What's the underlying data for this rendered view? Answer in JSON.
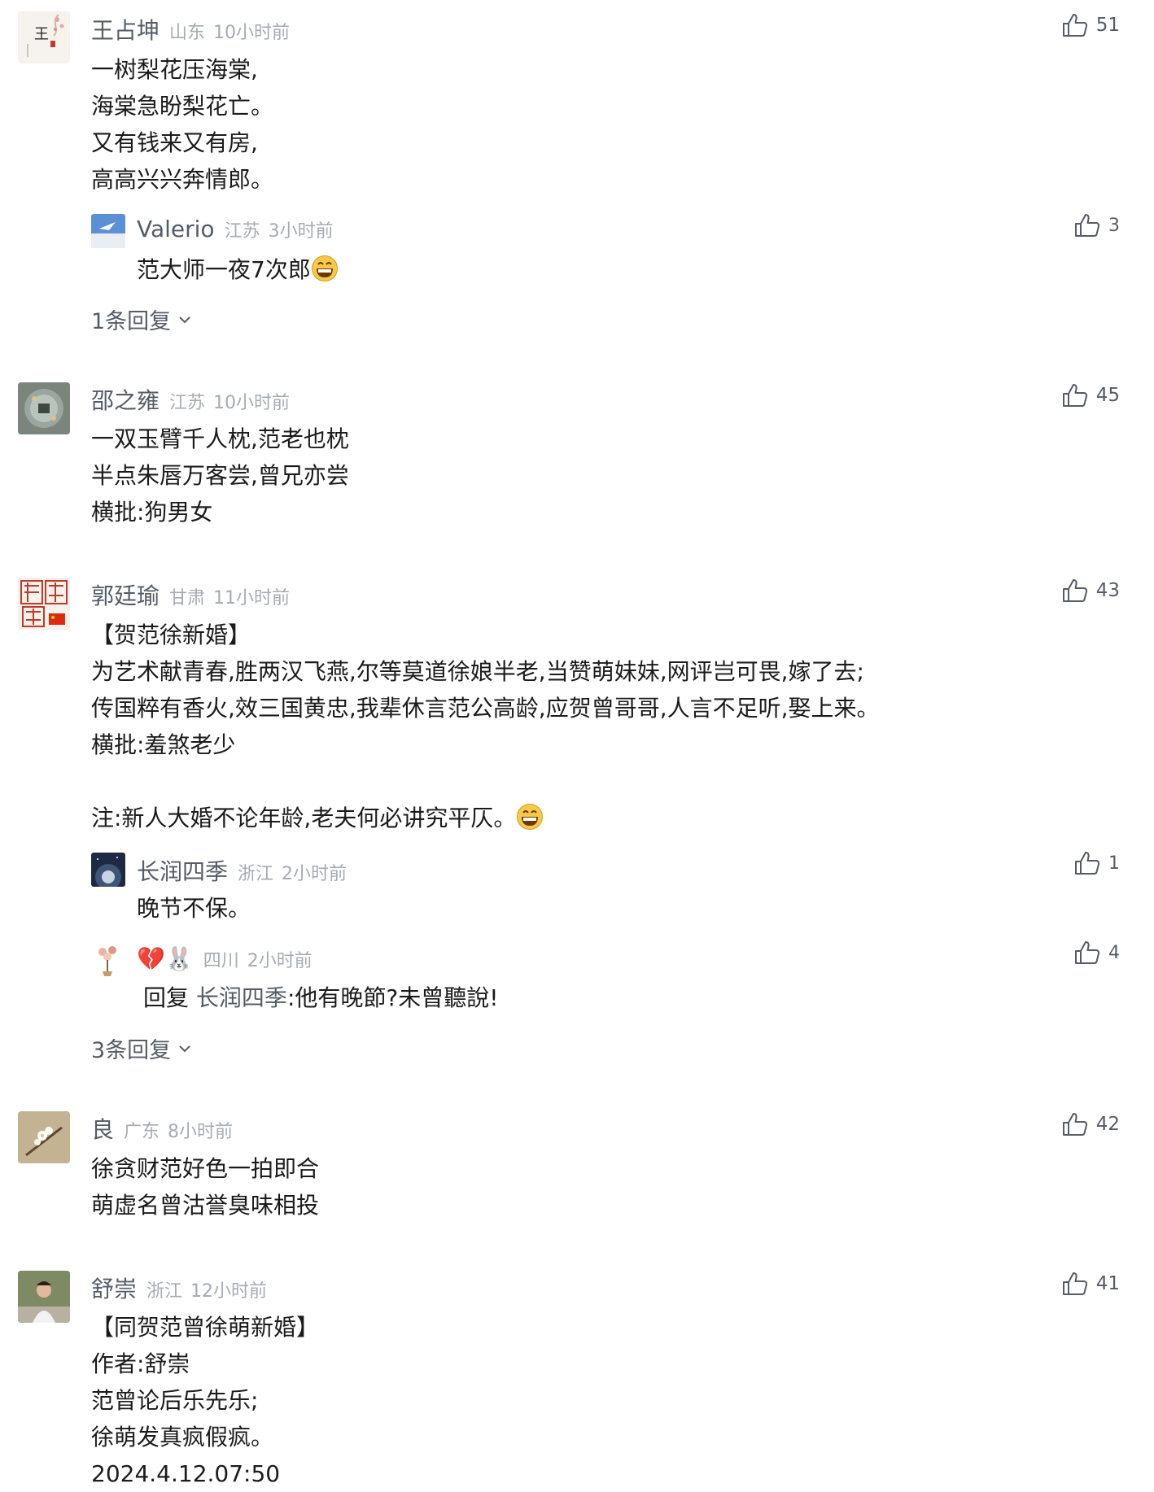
{
  "comments": [
    {
      "name": "王占坤",
      "region": "山东",
      "time": "10小时前",
      "likes": "51",
      "lines": [
        "一树梨花压海棠,",
        "海棠急盼梨花亡。",
        "又有钱来又有房,",
        "高高兴兴奔情郎。"
      ],
      "replies": [
        {
          "name": "Valerio",
          "region": "江苏",
          "time": "3小时前",
          "likes": "3",
          "text": "范大师一夜7次郎",
          "emoji": "grinning-face-emoji"
        }
      ],
      "more": "1条回复"
    },
    {
      "name": "邵之雍",
      "region": "江苏",
      "time": "10小时前",
      "likes": "45",
      "lines": [
        "一双玉臂千人枕,范老也枕",
        "半点朱唇万客尝,曾兄亦尝",
        "横批:狗男女"
      ]
    },
    {
      "name": "郭廷瑜",
      "region": "甘肃",
      "time": "11小时前",
      "likes": "43",
      "lines": [
        "【贺范徐新婚】",
        "为艺术献青春,胜两汉飞燕,尔等莫道徐娘半老,当赞萌妹妹,网评岂可畏,嫁了去;",
        "传国粹有香火,效三国黄忠,我辈休言范公高龄,应贺曾哥哥,人言不足听,娶上来。",
        "横批:羞煞老少",
        "",
        "注:新人大婚不论年龄,老夫何必讲究平仄。"
      ],
      "replies": [
        {
          "name": "长润四季",
          "region": "浙江",
          "time": "2小时前",
          "likes": "1",
          "text": "晚节不保。"
        },
        {
          "name": "💔🐰",
          "region": "四川",
          "time": "2小时前",
          "likes": "4",
          "reply_prefix": "回复",
          "reply_to": "长润四季",
          "text": ":他有晚節?未曾聽說!"
        }
      ],
      "more": "3条回复"
    },
    {
      "name": "良",
      "region": "广东",
      "time": "8小时前",
      "likes": "42",
      "lines": [
        "徐贪财范好色一拍即合",
        "萌虚名曾沽誉臭味相投"
      ]
    },
    {
      "name": "舒崇",
      "region": "浙江",
      "time": "12小时前",
      "likes": "41",
      "lines": [
        "【同贺范曾徐萌新婚】",
        "作者:舒崇",
        "范曾论后乐先乐;",
        "徐萌发真疯假疯。",
        "2024.4.12.07:50"
      ]
    }
  ],
  "colors": {
    "name": "#555c66",
    "meta": "#a6abb3",
    "text": "#1b1b1b"
  }
}
